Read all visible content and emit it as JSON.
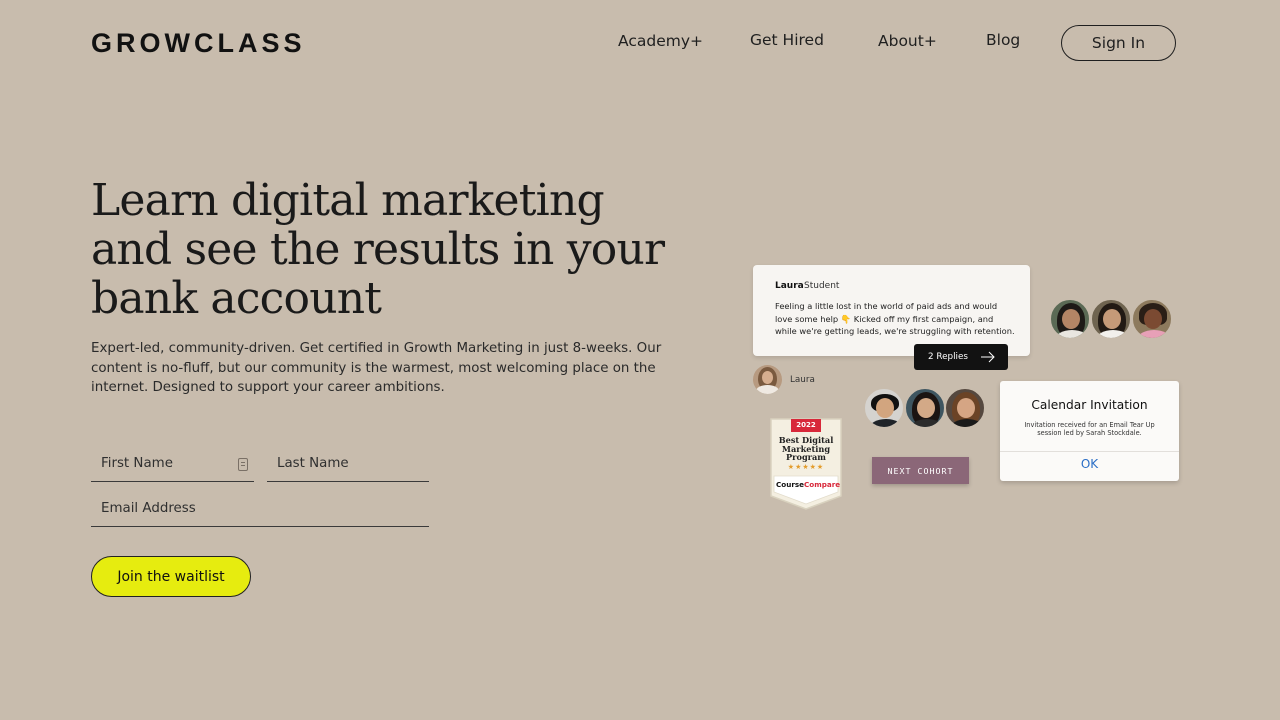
{
  "header": {
    "logo": "GROWCLASS",
    "nav": [
      {
        "label": "Academy+"
      },
      {
        "label": "Get Hired"
      },
      {
        "label": "About+"
      },
      {
        "label": "Blog"
      }
    ],
    "signin_label": "Sign In"
  },
  "hero": {
    "headline": "Learn digital marketing and see the results in your bank account",
    "subtext": "Expert-led, community-driven. Get certified in Growth Marketing in just 8-weeks. Our content is no-fluff, but our community is the warmest, most welcoming place on the internet. Designed to support your career ambitions."
  },
  "form": {
    "first_name_placeholder": "First Name",
    "last_name_placeholder": "Last Name",
    "email_placeholder": "Email Address",
    "submit_label": "Join the waitlist"
  },
  "showcase": {
    "post": {
      "author": "Laura",
      "role": "Student",
      "message": "Feeling a little lost in the world of paid ads and would love some help 👇 Kicked off my first campaign, and while we're getting leads, we're struggling with retention.",
      "replies_label": "2 Replies"
    },
    "commenter": "Laura",
    "badge": {
      "year": "2022",
      "title": "Best Digital Marketing Program",
      "stars": "★★★★★",
      "brand_a": "Course",
      "brand_b": "Compare"
    },
    "next_cohort_label": "NEXT COHORT",
    "calendar": {
      "title": "Calendar Invitation",
      "body": "Invitation received for an Email Tear Up session led by Sarah Stockdale.",
      "ok_label": "OK"
    }
  },
  "colors": {
    "background": "#c8bcad",
    "cta": "#e6ec0f",
    "cohort": "#8b6778",
    "link_blue": "#2a6ec6"
  }
}
